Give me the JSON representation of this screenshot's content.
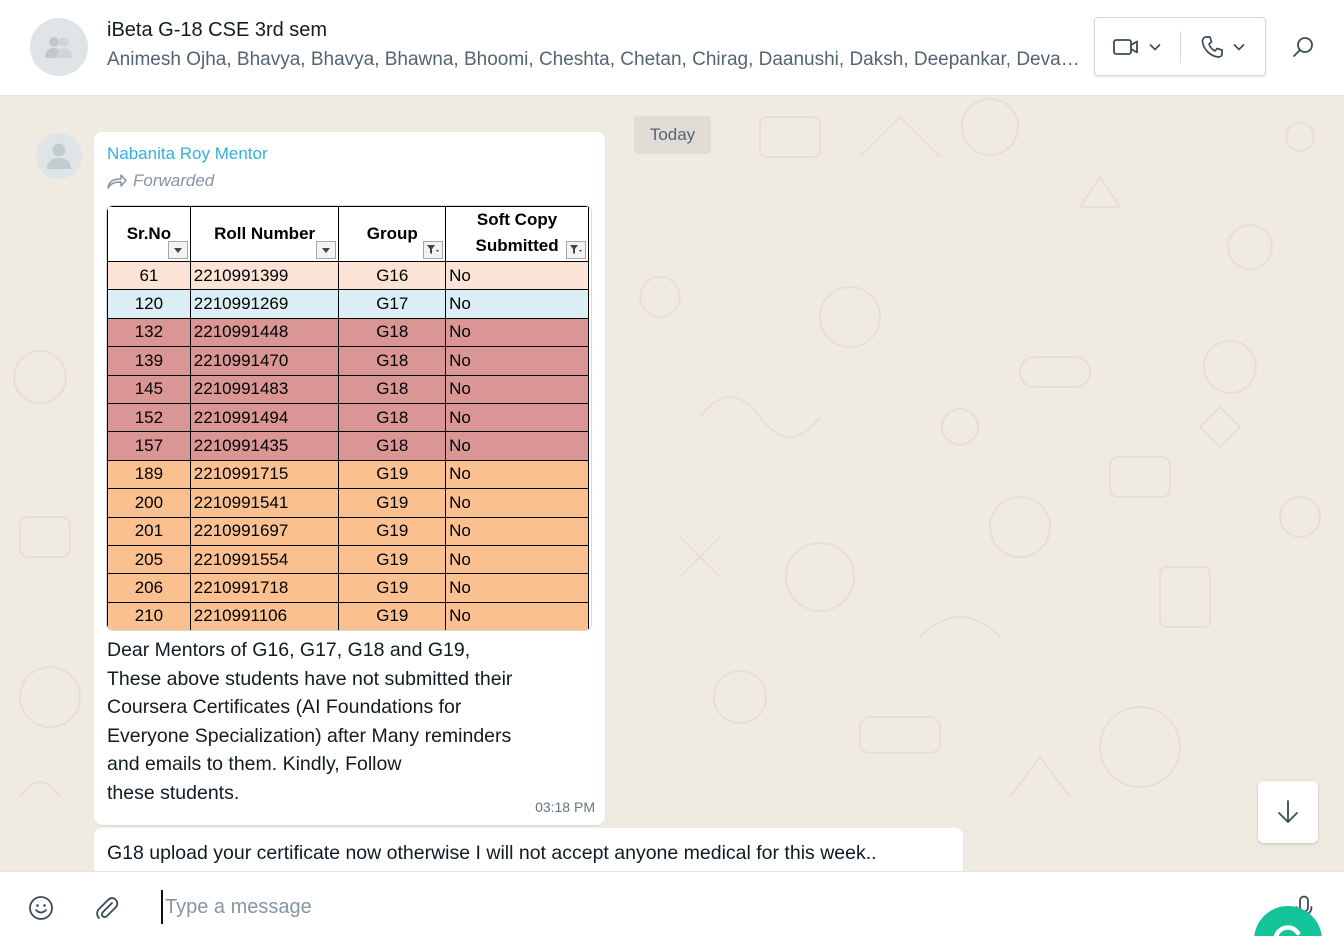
{
  "header": {
    "title": "iBeta G-18 CSE 3rd sem",
    "members": "Animesh Ojha, Bhavya, Bhavya, Bhawna, Bhoomi, Cheshta, Chetan, Chirag, Daanushi, Daksh, Deepankar, Devanshi, Dhruv, Gaurav",
    "icons": {
      "avatar": "group-icon",
      "video": "video-call-icon",
      "voice": "voice-call-icon",
      "search": "search-icon"
    }
  },
  "chat": {
    "date_chip": "Today",
    "message1": {
      "sender": "Nabanita Roy Mentor",
      "forwarded_label": "Forwarded",
      "sheet": {
        "headers": [
          "Sr.No",
          "Roll Number",
          "Group",
          "Soft Copy Submitted"
        ],
        "rows": [
          [
            "61",
            "2210991399",
            "G16",
            "No"
          ],
          [
            "120",
            "2210991269",
            "G17",
            "No"
          ],
          [
            "132",
            "2210991448",
            "G18",
            "No"
          ],
          [
            "139",
            "2210991470",
            "G18",
            "No"
          ],
          [
            "145",
            "2210991483",
            "G18",
            "No"
          ],
          [
            "152",
            "2210991494",
            "G18",
            "No"
          ],
          [
            "157",
            "2210991435",
            "G18",
            "No"
          ],
          [
            "189",
            "2210991715",
            "G19",
            "No"
          ],
          [
            "200",
            "2210991541",
            "G19",
            "No"
          ],
          [
            "201",
            "2210991697",
            "G19",
            "No"
          ],
          [
            "205",
            "2210991554",
            "G19",
            "No"
          ],
          [
            "206",
            "2210991718",
            "G19",
            "No"
          ],
          [
            "210",
            "2210991106",
            "G19",
            "No"
          ]
        ],
        "group_colors": {
          "G16": "#fbe4d6",
          "G17": "#daeef3",
          "G18": "#da9694",
          "G19": "#fac090"
        }
      },
      "lines": [
        "Dear Mentors of G16, G17, G18 and G19,",
        "These above students have not submitted their",
        "Coursera Certificates (AI Foundations for",
        "Everyone Specialization) after Many reminders",
        "and emails to them. Kindly, Follow",
        "these students."
      ],
      "time": "03:18 PM"
    },
    "message2": {
      "text": "G18 upload your certificate now otherwise I will not accept anyone medical for this week.."
    }
  },
  "composer": {
    "placeholder": "Type a message",
    "icons": {
      "emoji": "emoji-icon",
      "attach": "paperclip-icon",
      "mic": "microphone-icon",
      "grammarly": "grammarly-icon"
    }
  }
}
